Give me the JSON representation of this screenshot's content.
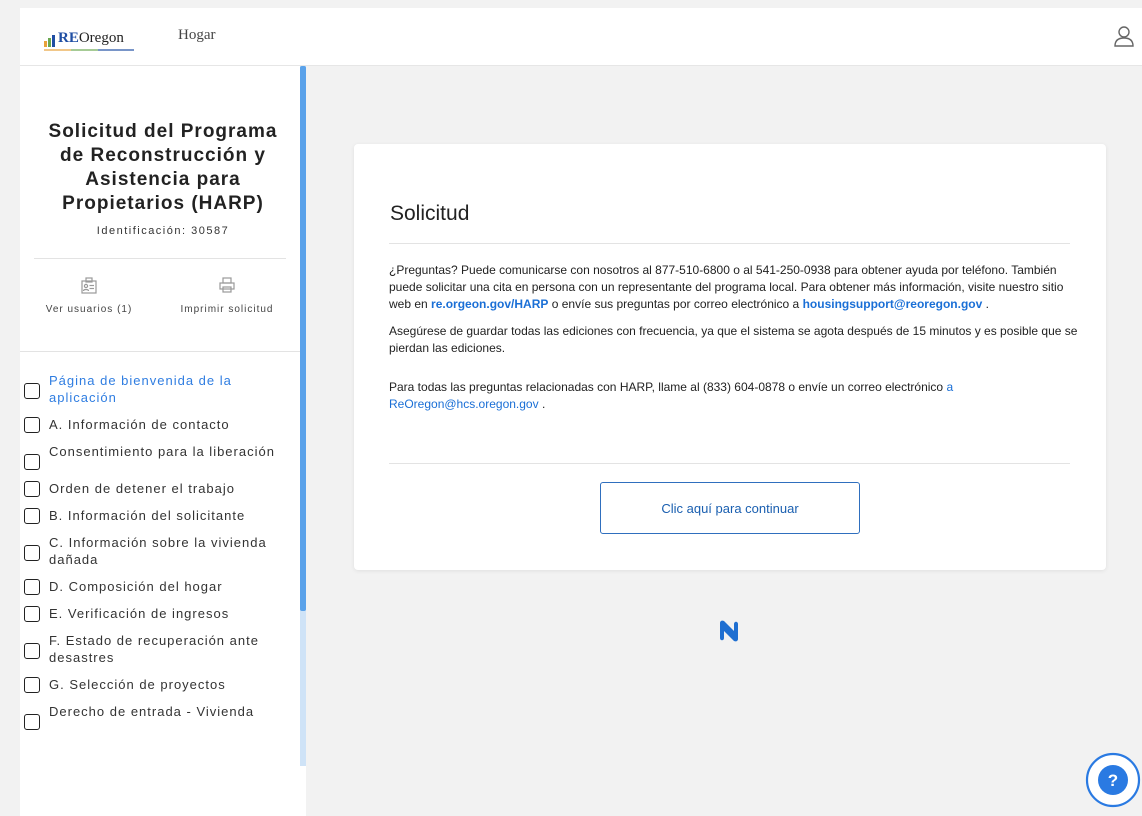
{
  "header": {
    "logo_re": "RE",
    "logo_oregon": "Oregon",
    "nav_home": "Hogar",
    "colors": {
      "logo_bar_1": "#e8a23a",
      "logo_bar_2": "#6aa84f",
      "logo_bar_3": "#1f4ea3"
    }
  },
  "sidebar": {
    "title": "Solicitud del Programa de Reconstrucción y Asistencia para Propietarios (HARP)",
    "identification": "Identificación: 30587",
    "actions": [
      {
        "label": "Ver usuarios (1)",
        "icon": "users-icon"
      },
      {
        "label": "Imprimir solicitud",
        "icon": "printer-icon"
      }
    ],
    "items": [
      {
        "label": "Página de bienvenida de la aplicación",
        "active": true
      },
      {
        "label": "A. Información de contacto"
      },
      {
        "label": "Consentimiento para la liberación"
      },
      {
        "label": "Orden de detener el trabajo"
      },
      {
        "label": "B. Información del solicitante"
      },
      {
        "label": "C. Información sobre la vivienda dañada"
      },
      {
        "label": "D. Composición del hogar"
      },
      {
        "label": "E. Verificación de ingresos"
      },
      {
        "label": "F. Estado de recuperación ante desastres"
      },
      {
        "label": "G. Selección de proyectos"
      },
      {
        "label": "Derecho de entrada - Vivienda"
      }
    ]
  },
  "card": {
    "title": "Solicitud",
    "p1_text": "¿Preguntas? Puede comunicarse con nosotros al 877-510-6800 o al 541-250-0938 para obtener ayuda por teléfono. También puede solicitar una cita en persona con un representante del programa local. Para obtener más información, visite nuestro sitio web en",
    "p1_link1": "re.orgeon.gov/HARP",
    "p1_mid": "o envíe sus preguntas por correo electrónico a",
    "p1_link2": "housingsupport@reoregon.gov",
    "p1_end": ".",
    "p2_text": "Asegúrese de guardar todas las ediciones con frecuencia, ya que el sistema se agota después de 15 minutos y es posible que se pierdan las ediciones.",
    "p3_text": "Para todas las preguntas relacionadas con HARP, llame al (833) 604-0878 o envíe un correo electrónico",
    "p3_link": "a ReOregon@hcs.oregon.gov",
    "p3_end": ".",
    "continue_label": "Clic aquí para continuar"
  },
  "help": {
    "label": "?"
  },
  "colors": {
    "accent": "#2f7de1",
    "link": "#1a6fd6",
    "button_border": "#2f6fbe",
    "scroll_thumb": "#5aa2ea"
  }
}
